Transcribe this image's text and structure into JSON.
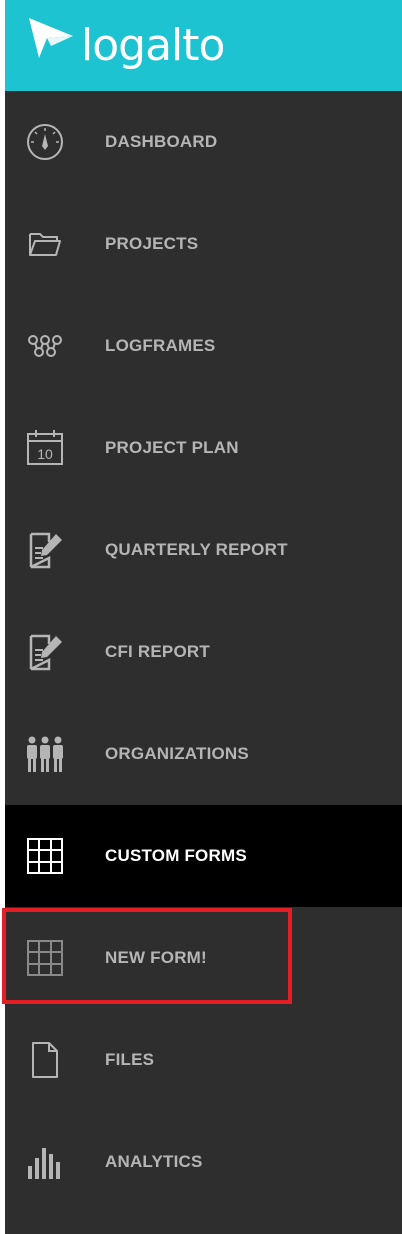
{
  "brand": {
    "name": "logalto",
    "background": "#1dc3d0"
  },
  "nav": {
    "items": [
      {
        "label": "DASHBOARD",
        "icon": "dashboard-gauge-icon"
      },
      {
        "label": "PROJECTS",
        "icon": "folder-icon"
      },
      {
        "label": "LOGFRAMES",
        "icon": "logframe-nodes-icon"
      },
      {
        "label": "PROJECT PLAN",
        "icon": "calendar-icon",
        "icon_text": "10"
      },
      {
        "label": "QUARTERLY REPORT",
        "icon": "report-edit-icon"
      },
      {
        "label": "CFI REPORT",
        "icon": "report-edit-icon"
      },
      {
        "label": "ORGANIZATIONS",
        "icon": "people-group-icon"
      },
      {
        "label": "CUSTOM FORMS",
        "icon": "grid-icon",
        "active": true
      },
      {
        "label": "NEW FORM!",
        "icon": "grid-icon",
        "highlighted": true
      },
      {
        "label": "FILES",
        "icon": "file-icon"
      },
      {
        "label": "ANALYTICS",
        "icon": "bar-chart-icon"
      }
    ]
  },
  "colors": {
    "sidebar_bg": "#2e2e2e",
    "active_bg": "#000000",
    "label": "#b5b5b5",
    "active_label": "#ffffff",
    "highlight_border": "#e31e24"
  }
}
